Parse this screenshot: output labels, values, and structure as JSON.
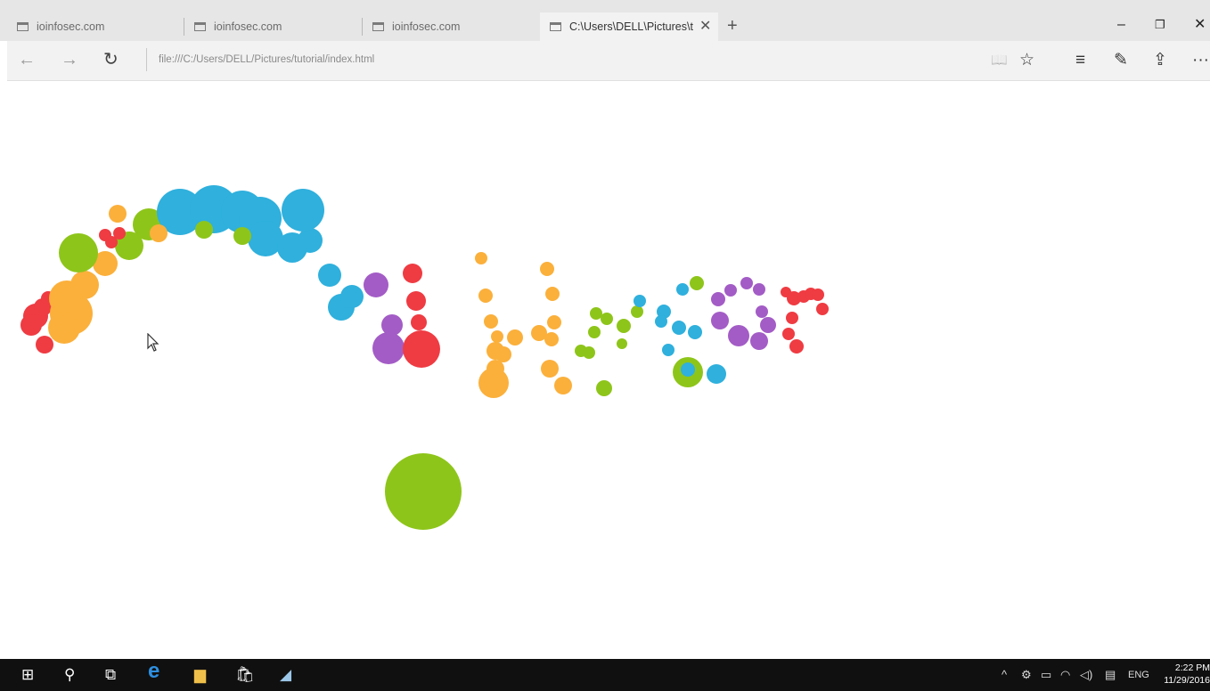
{
  "tabs": [
    {
      "label": "ioinfosec.com",
      "active": false
    },
    {
      "label": "ioinfosec.com",
      "active": false
    },
    {
      "label": "ioinfosec.com",
      "active": false
    },
    {
      "label": "C:\\Users\\DELL\\Pictures\\t",
      "active": true
    }
  ],
  "tab_close_glyph": "✕",
  "new_tab_glyph": "+",
  "window_controls": {
    "minimize": "–",
    "restore": "❐",
    "close": "✕"
  },
  "nav": {
    "back": "←",
    "forward": "→",
    "refresh": "↻"
  },
  "address": {
    "url": "file:///C:/Users/DELL/Pictures/tutorial/index.html"
  },
  "toolbar": {
    "reading_view": "📖",
    "favorite": "☆",
    "hub": "≡",
    "web_note": "✎",
    "share": "⇪",
    "more": "···"
  },
  "taskbar": {
    "start": "⊞",
    "search": "⚲",
    "task_view": "⧉",
    "edge": "e",
    "explorer": "▆",
    "store": "🛍",
    "app": "◢",
    "tray": {
      "chevron": "^",
      "ime": "ENG",
      "time": "2:22 PM",
      "date": "11/29/2016"
    }
  },
  "colors": {
    "red": "#ef3b42",
    "orange": "#fbb03b",
    "green": "#8ec51a",
    "blue": "#2fb0dd",
    "purple": "#a35cc6"
  },
  "icons": [
    "tab-icon",
    "close-icon",
    "plus-icon",
    "back-icon",
    "forward-icon",
    "refresh-icon",
    "book-icon",
    "star-icon",
    "hub-icon",
    "pen-icon",
    "share-icon",
    "more-icon",
    "windows-icon",
    "search-icon",
    "task-view-icon",
    "edge-icon",
    "folder-icon",
    "store-icon",
    "cursor-icon"
  ]
}
